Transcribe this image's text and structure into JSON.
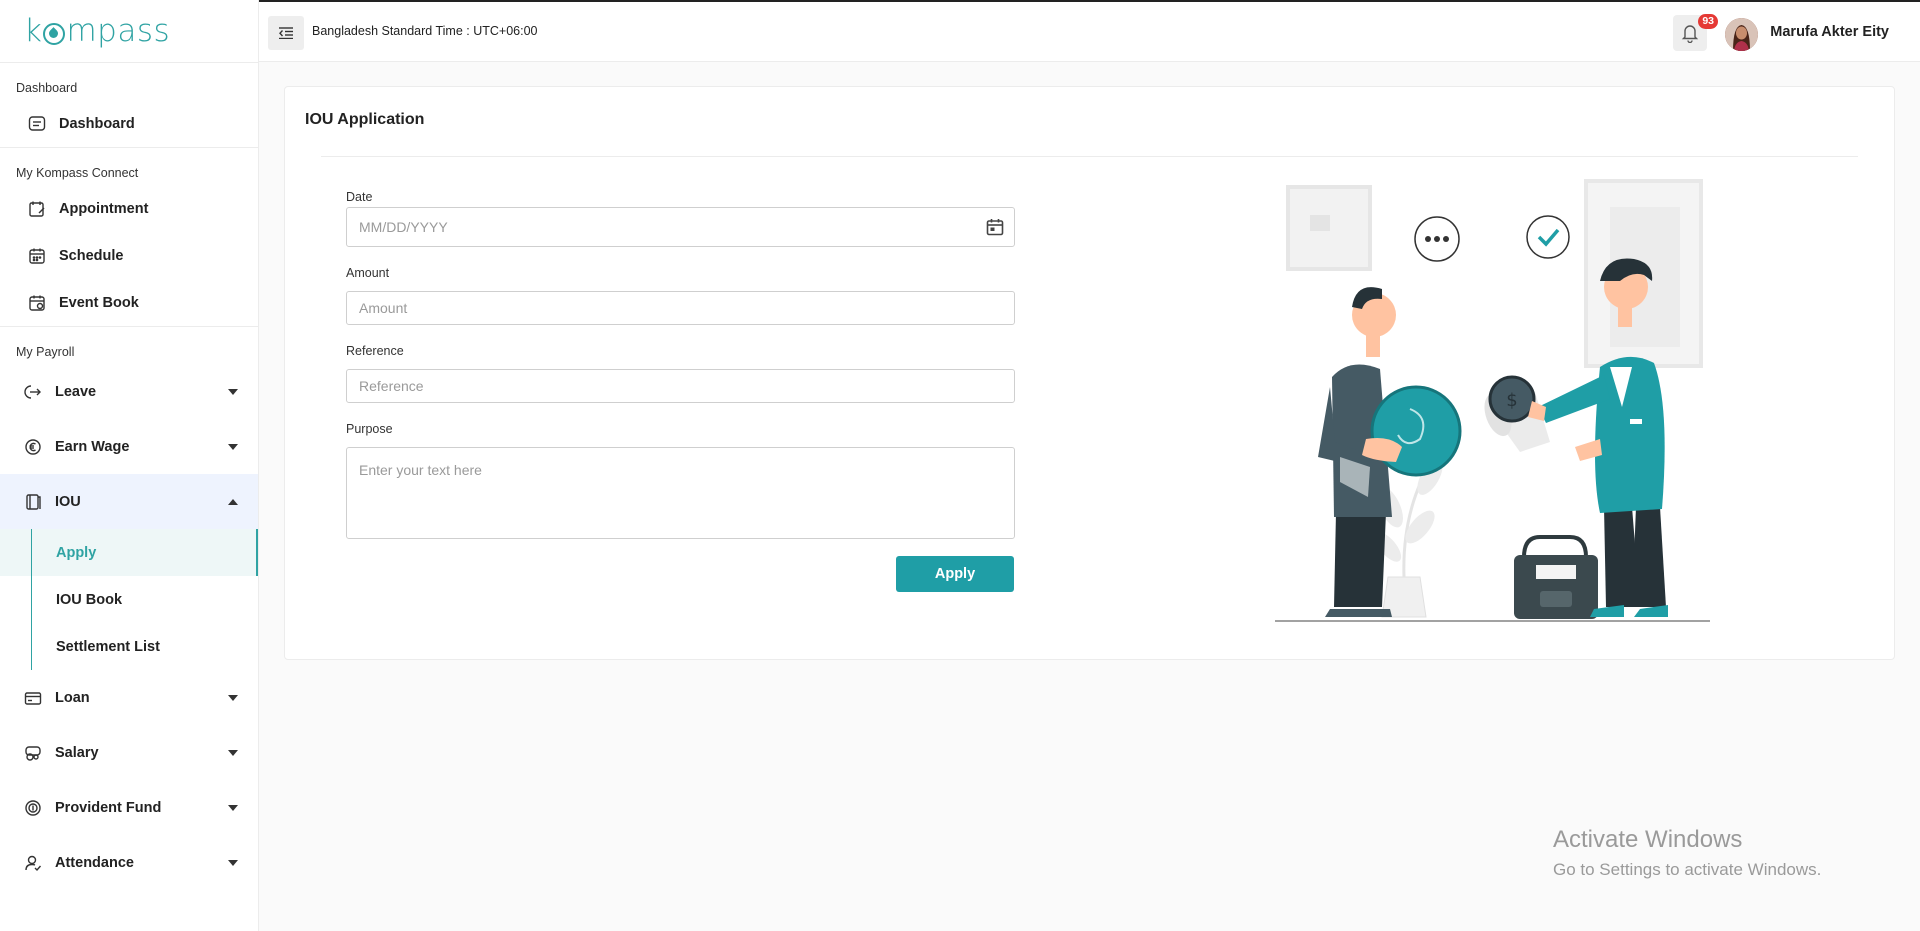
{
  "sidebar": {
    "logo": "kompass",
    "sections": {
      "dashboard": "Dashboard",
      "connect": "My Kompass Connect",
      "payroll": "My Payroll"
    },
    "items": {
      "dashboard": "Dashboard",
      "appointment": "Appointment",
      "schedule": "Schedule",
      "event_book": "Event Book",
      "leave": "Leave",
      "earn_wage": "Earn Wage",
      "iou": "IOU",
      "iou_apply": "Apply",
      "iou_book": "IOU Book",
      "settlement_list": "Settlement List",
      "loan": "Loan",
      "salary": "Salary",
      "provident_fund": "Provident Fund",
      "attendance": "Attendance"
    }
  },
  "topbar": {
    "timezone": "Bangladesh Standard Time : UTC+06:00",
    "notification_count": "93",
    "user_name": "Marufa Akter Eity"
  },
  "form": {
    "title": "IOU Application",
    "date_label": "Date",
    "date_placeholder": "MM/DD/YYYY",
    "amount_label": "Amount",
    "amount_placeholder": "Amount",
    "reference_label": "Reference",
    "reference_placeholder": "Reference",
    "purpose_label": "Purpose",
    "purpose_placeholder": "Enter your text here",
    "apply_label": "Apply"
  },
  "watermark": {
    "line1": "Activate Windows",
    "line2": "Go to Settings to activate Windows."
  },
  "colors": {
    "accent": "#1f9ea6",
    "badge": "#e53935",
    "active_bg": "#eef3fe"
  }
}
